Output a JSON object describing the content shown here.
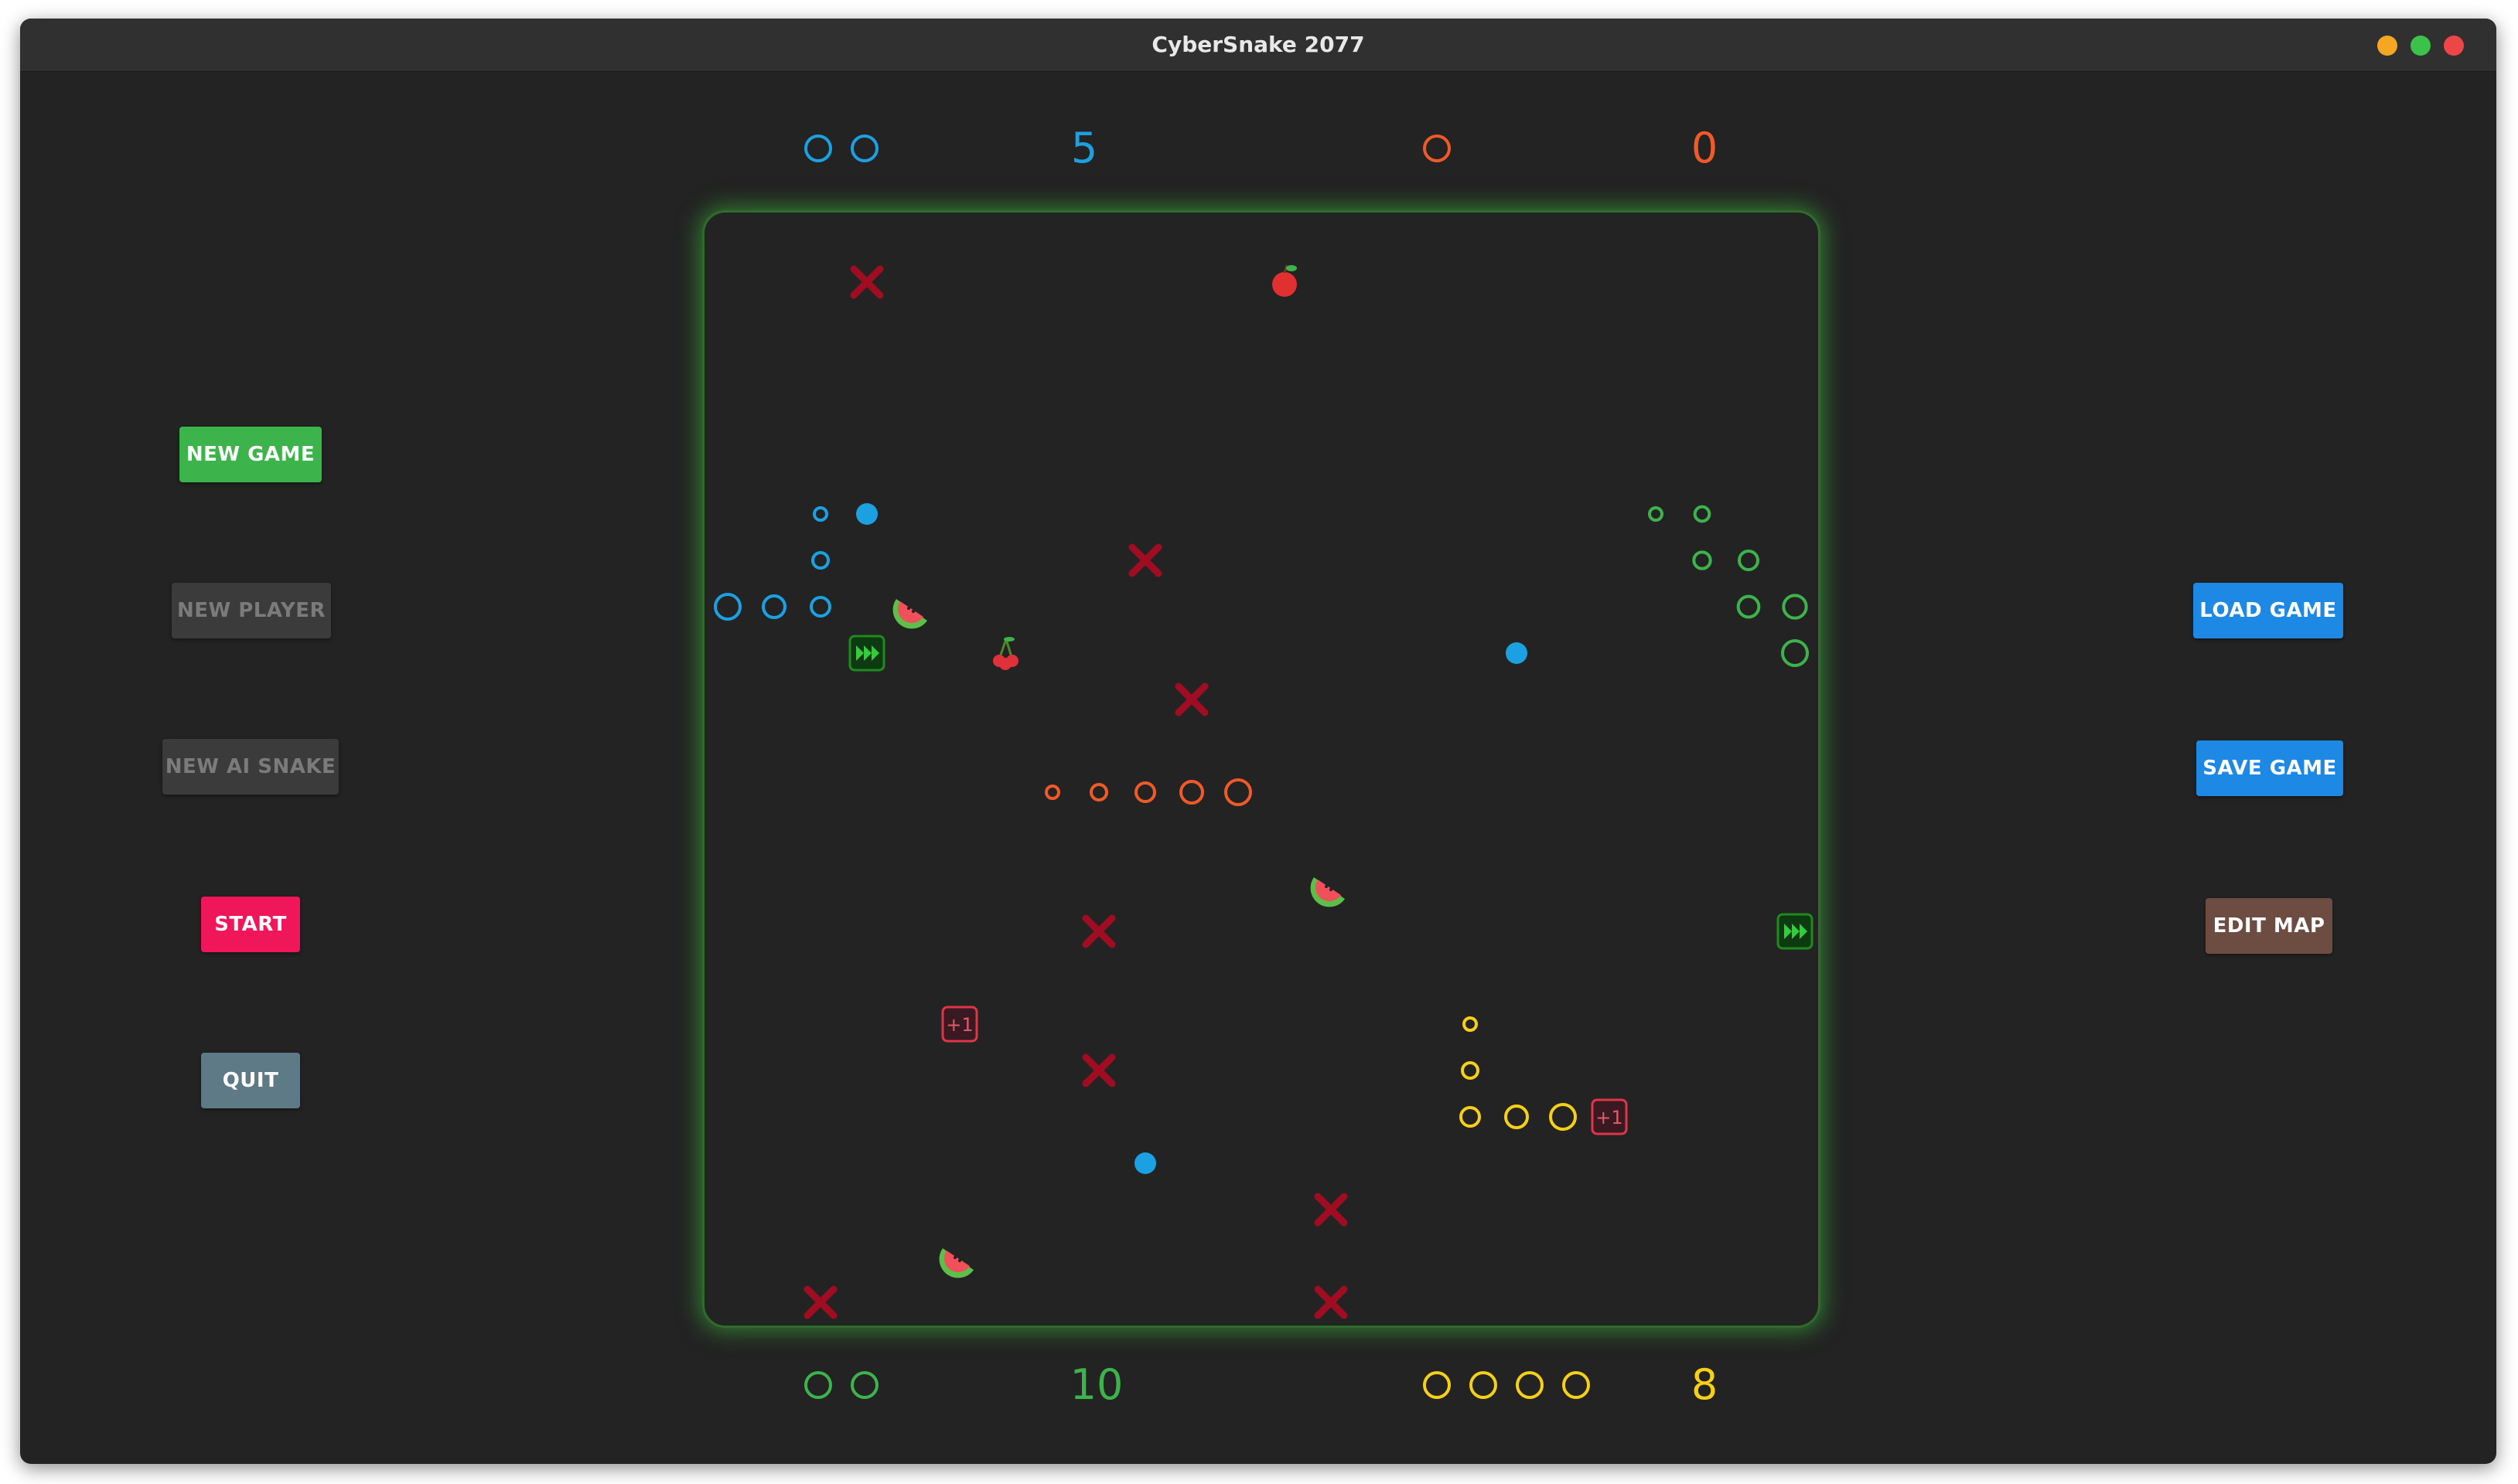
{
  "window": {
    "title": "CyberSnake 2077"
  },
  "buttons": {
    "new_game": "NEW GAME",
    "new_player": "NEW PLAYER",
    "new_ai_snake": "NEW AI SNAKE",
    "start": "START",
    "quit": "QUIT",
    "load_game": "LOAD GAME",
    "save_game": "SAVE GAME",
    "edit_map": "EDIT MAP"
  },
  "colors": {
    "blue": "#1ba1e2",
    "orange": "#f05a28",
    "green": "#3cb44b",
    "yellow": "#f5d016",
    "red_x": "#a00d22",
    "new_game": "#3cb44b",
    "start": "#f0165a",
    "quit": "#5d7a86",
    "load_save": "#1e88e5",
    "edit_map": "#6d4c41",
    "disabled": "#3b3b3b"
  },
  "players": [
    {
      "color": "blue",
      "lives": 2,
      "score": "5"
    },
    {
      "color": "orange",
      "lives": 1,
      "score": "0"
    },
    {
      "color": "green",
      "lives": 2,
      "score": "10"
    },
    {
      "color": "yellow",
      "lives": 4,
      "score": "8"
    }
  ],
  "board": {
    "cols": 24,
    "rows": 24,
    "snakes": [
      {
        "color": "blue",
        "cells": [
          [
            8,
            0
          ],
          [
            8,
            1
          ],
          [
            8,
            2
          ],
          [
            7,
            2
          ],
          [
            6,
            2
          ]
        ]
      },
      {
        "color": "orange",
        "cells": [
          [
            12,
            11
          ],
          [
            12,
            10
          ],
          [
            12,
            9
          ],
          [
            12,
            8
          ],
          [
            12,
            7
          ]
        ]
      },
      {
        "color": "green",
        "cells": [
          [
            9,
            23
          ],
          [
            8,
            23
          ],
          [
            8,
            22
          ],
          [
            7,
            22
          ],
          [
            7,
            21
          ],
          [
            6,
            21
          ],
          [
            6,
            20
          ]
        ]
      },
      {
        "color": "yellow",
        "cells": [
          [
            19,
            18
          ],
          [
            19,
            17
          ],
          [
            19,
            16
          ],
          [
            18,
            16
          ],
          [
            17,
            16
          ]
        ]
      }
    ],
    "walls": [
      [
        1,
        3
      ],
      [
        7,
        9
      ],
      [
        10,
        10
      ],
      [
        15,
        8
      ],
      [
        18,
        8
      ],
      [
        21,
        13
      ],
      [
        23,
        2
      ],
      [
        23,
        13
      ]
    ],
    "bonuses": [
      [
        17,
        5
      ],
      [
        19,
        19
      ]
    ],
    "bonus_label": "+1",
    "speed_boosts": [
      [
        9,
        3
      ],
      [
        15,
        23
      ]
    ],
    "fruits": [
      {
        "kind": "apple",
        "cell": [
          1,
          12
        ]
      },
      {
        "kind": "watermelon",
        "cell": [
          8,
          4
        ]
      },
      {
        "kind": "cherry",
        "cell": [
          9,
          6
        ]
      },
      {
        "kind": "watermelon",
        "cell": [
          14,
          13
        ]
      },
      {
        "kind": "watermelon",
        "cell": [
          22,
          5
        ]
      }
    ],
    "pellets": [
      [
        6,
        3
      ],
      [
        9,
        17
      ],
      [
        20,
        9
      ]
    ]
  }
}
